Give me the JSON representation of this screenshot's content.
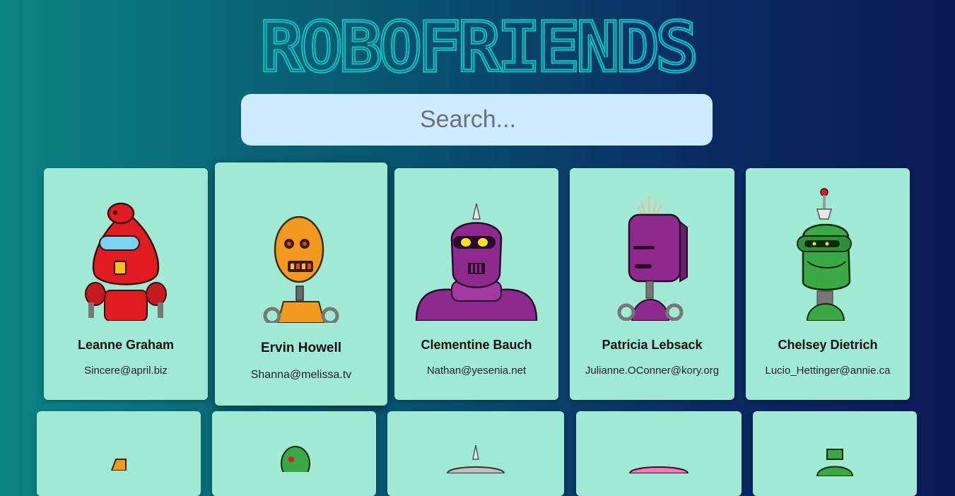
{
  "app": {
    "title": "ROBOFRIENDS"
  },
  "search": {
    "placeholder": "Search..."
  },
  "robots": [
    {
      "name": "Leanne Graham",
      "email": "Sincere@april.biz",
      "color": "#e11b22"
    },
    {
      "name": "Ervin Howell",
      "email": "Shanna@melissa.tv",
      "color": "#f39a1e"
    },
    {
      "name": "Clementine Bauch",
      "email": "Nathan@yesenia.net",
      "color": "#8e2a8e"
    },
    {
      "name": "Patricia Lebsack",
      "email": "Julianne.OConner@kory.org",
      "color": "#8e2a8e"
    },
    {
      "name": "Chelsey Dietrich",
      "email": "Lucio_Hettinger@annie.ca",
      "color": "#3aa845"
    }
  ],
  "colors": {
    "title": "#11c4c4",
    "card": "#a0ead4",
    "search_bg": "#cdebff"
  }
}
